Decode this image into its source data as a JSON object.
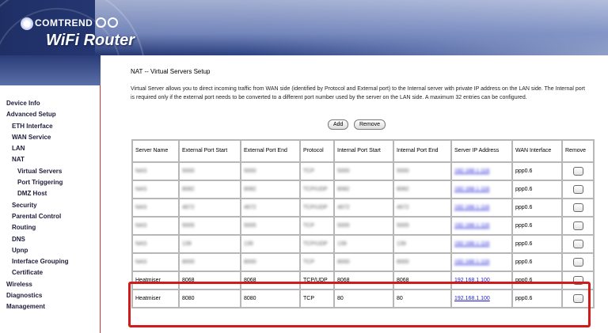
{
  "header": {
    "brand": "COMTREND",
    "title": "WiFi Router"
  },
  "sidebar": {
    "items": [
      {
        "label": "Device Info",
        "level": 0
      },
      {
        "label": "Advanced Setup",
        "level": 0
      },
      {
        "label": "ETH Interface",
        "level": 1
      },
      {
        "label": "WAN Service",
        "level": 1
      },
      {
        "label": "LAN",
        "level": 1
      },
      {
        "label": "NAT",
        "level": 1
      },
      {
        "label": "Virtual Servers",
        "level": 2
      },
      {
        "label": "Port Triggering",
        "level": 2
      },
      {
        "label": "DMZ Host",
        "level": 2
      },
      {
        "label": "Security",
        "level": 1
      },
      {
        "label": "Parental Control",
        "level": 1
      },
      {
        "label": "Routing",
        "level": 1
      },
      {
        "label": "DNS",
        "level": 1
      },
      {
        "label": "Upnp",
        "level": 1
      },
      {
        "label": "Interface Grouping",
        "level": 1
      },
      {
        "label": "Certificate",
        "level": 1
      },
      {
        "label": "Wireless",
        "level": 0
      },
      {
        "label": "Diagnostics",
        "level": 0
      },
      {
        "label": "Management",
        "level": 0
      }
    ]
  },
  "main": {
    "title": "NAT -- Virtual Servers Setup",
    "description": "Virtual Server allows you to direct incoming traffic from WAN side (identified by Protocol and External port) to the Internal server with private IP address on the LAN side. The Internal port is required only if the external port needs to be converted to a different port number used by the server on the LAN side. A maximum 32 entries can be configured.",
    "add_label": "Add",
    "remove_label": "Remove"
  },
  "table": {
    "headers": [
      "Server Name",
      "External Port Start",
      "External Port End",
      "Protocol",
      "Internal Port Start",
      "Internal Port End",
      "Server IP Address",
      "WAN Interface",
      "Remove"
    ],
    "blurred_rows": [
      {
        "name": "NAS",
        "ext_start": "5000",
        "ext_end": "5000",
        "protocol": "TCP",
        "int_start": "5000",
        "int_end": "5000",
        "ip": "192.168.1.116",
        "wan": "ppp0.6"
      },
      {
        "name": "NAS",
        "ext_start": "8082",
        "ext_end": "8082",
        "protocol": "TCP/UDP",
        "int_start": "8082",
        "int_end": "8082",
        "ip": "192.168.1.116",
        "wan": "ppp0.6"
      },
      {
        "name": "NAS",
        "ext_start": "4672",
        "ext_end": "4672",
        "protocol": "TCP/UDP",
        "int_start": "4672",
        "int_end": "4672",
        "ip": "192.168.1.116",
        "wan": "ppp0.6"
      },
      {
        "name": "NAS",
        "ext_start": "5005",
        "ext_end": "5005",
        "protocol": "TCP",
        "int_start": "5005",
        "int_end": "5005",
        "ip": "192.168.1.116",
        "wan": "ppp0.6"
      },
      {
        "name": "NAS",
        "ext_start": "139",
        "ext_end": "139",
        "protocol": "TCP/UDP",
        "int_start": "139",
        "int_end": "139",
        "ip": "192.168.1.116",
        "wan": "ppp0.6"
      },
      {
        "name": "NAS",
        "ext_start": "8000",
        "ext_end": "8000",
        "protocol": "TCP",
        "int_start": "8000",
        "int_end": "8000",
        "ip": "192.168.1.116",
        "wan": "ppp0.6"
      }
    ],
    "rows": [
      {
        "name": "Heatmiser",
        "ext_start": "8068",
        "ext_end": "8068",
        "protocol": "TCP/UDP",
        "int_start": "8068",
        "int_end": "8068",
        "ip": "192.168.1.100",
        "wan": "ppp0.6"
      },
      {
        "name": "Heatmiser",
        "ext_start": "8080",
        "ext_end": "8080",
        "protocol": "TCP",
        "int_start": "80",
        "int_end": "80",
        "ip": "192.168.1.100",
        "wan": "ppp0.6"
      }
    ]
  },
  "colors": {
    "highlight": "#d11a1a",
    "banner": "#2c4182"
  }
}
